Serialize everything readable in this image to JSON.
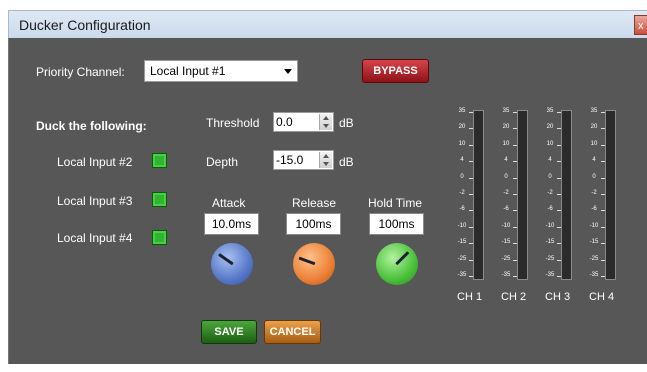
{
  "window": {
    "title": "Ducker Configuration"
  },
  "priority": {
    "label": "Priority Channel:",
    "selected": "Local Input #1"
  },
  "bypass_label": "BYPASS",
  "duck": {
    "heading": "Duck the following:",
    "inputs": [
      {
        "label": "Local Input #2",
        "checked": true
      },
      {
        "label": "Local Input #3",
        "checked": true
      },
      {
        "label": "Local Input #4",
        "checked": true
      }
    ]
  },
  "threshold": {
    "label": "Threshold",
    "value": "0.0",
    "unit": "dB"
  },
  "depth": {
    "label": "Depth",
    "value": "-15.0",
    "unit": "dB"
  },
  "knobs": [
    {
      "label": "Attack",
      "value": "10.0ms",
      "color": "#5578c8"
    },
    {
      "label": "Release",
      "value": "100ms",
      "color": "#ec8036"
    },
    {
      "label": "Hold Time",
      "value": "100ms",
      "color": "#49c03a"
    }
  ],
  "meters": {
    "scale": [
      "35",
      "20",
      "10",
      "4",
      "0",
      "-2",
      "-6",
      "-10",
      "-15",
      "-25",
      "-35"
    ],
    "channels": [
      "CH 1",
      "CH 2",
      "CH 3",
      "CH 4"
    ]
  },
  "buttons": {
    "save": "SAVE",
    "cancel": "CANCEL"
  },
  "colors": {
    "panel": "#575757",
    "bypass": "#b01e24",
    "save": "#2e7d22",
    "cancel": "#cc7a22",
    "checkbox": "#2fb52f"
  }
}
